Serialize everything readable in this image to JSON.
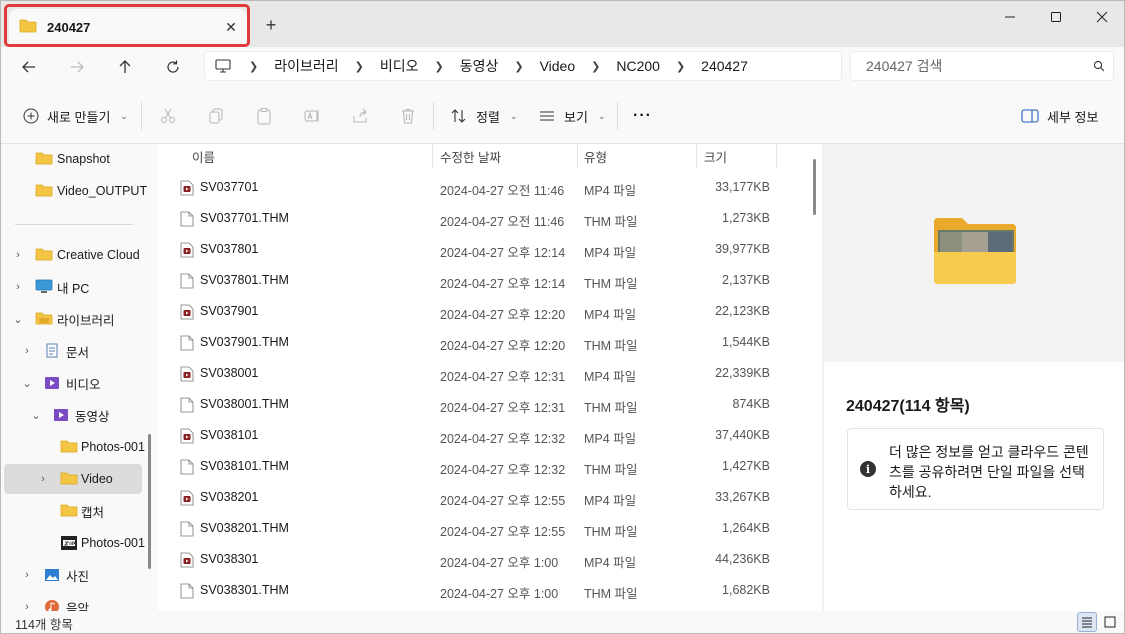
{
  "window": {
    "tab_title": "240427",
    "tab_close": "✕",
    "new_tab": "+"
  },
  "address": {
    "breadcrumbs": [
      "라이브러리",
      "비디오",
      "동영상",
      "Video",
      "NC200",
      "240427"
    ],
    "search_placeholder": "240427 검색"
  },
  "toolbar": {
    "new_label": "새로 만들기",
    "sort_label": "정렬",
    "view_label": "보기",
    "more_label": "···",
    "details_label": "세부 정보"
  },
  "nav": {
    "items": [
      {
        "label": "Snapshot",
        "icon": "folder-icon"
      },
      {
        "label": "Video_OUTPUT",
        "icon": "folder-icon"
      },
      {
        "label": "Creative Cloud",
        "icon": "folder-icon"
      },
      {
        "label": "내 PC",
        "icon": "pc-icon"
      },
      {
        "label": "라이브러리",
        "icon": "library-folder-icon"
      },
      {
        "label": "문서",
        "icon": "documents-icon"
      },
      {
        "label": "비디오",
        "icon": "videos-icon"
      },
      {
        "label": "동영상",
        "icon": "videos-icon"
      },
      {
        "label": "Photos-001",
        "icon": "folder-icon"
      },
      {
        "label": "Video",
        "icon": "folder-icon"
      },
      {
        "label": "캡처",
        "icon": "folder-icon"
      },
      {
        "label": "Photos-001",
        "icon": "zip-folder-icon"
      },
      {
        "label": "사진",
        "icon": "pictures-icon"
      },
      {
        "label": "음악",
        "icon": "music-icon"
      }
    ]
  },
  "columns": {
    "name": "이름",
    "date": "수정한 날짜",
    "type": "유형",
    "size": "크기"
  },
  "files": [
    {
      "name": "SV037701",
      "date": "2024-04-27 오전 11:46",
      "type": "MP4 파일",
      "size": "33,177KB",
      "kind": "mp4"
    },
    {
      "name": "SV037701.THM",
      "date": "2024-04-27 오전 11:46",
      "type": "THM 파일",
      "size": "1,273KB",
      "kind": "thm"
    },
    {
      "name": "SV037801",
      "date": "2024-04-27 오후 12:14",
      "type": "MP4 파일",
      "size": "39,977KB",
      "kind": "mp4"
    },
    {
      "name": "SV037801.THM",
      "date": "2024-04-27 오후 12:14",
      "type": "THM 파일",
      "size": "2,137KB",
      "kind": "thm"
    },
    {
      "name": "SV037901",
      "date": "2024-04-27 오후 12:20",
      "type": "MP4 파일",
      "size": "22,123KB",
      "kind": "mp4"
    },
    {
      "name": "SV037901.THM",
      "date": "2024-04-27 오후 12:20",
      "type": "THM 파일",
      "size": "1,544KB",
      "kind": "thm"
    },
    {
      "name": "SV038001",
      "date": "2024-04-27 오후 12:31",
      "type": "MP4 파일",
      "size": "22,339KB",
      "kind": "mp4"
    },
    {
      "name": "SV038001.THM",
      "date": "2024-04-27 오후 12:31",
      "type": "THM 파일",
      "size": "874KB",
      "kind": "thm"
    },
    {
      "name": "SV038101",
      "date": "2024-04-27 오후 12:32",
      "type": "MP4 파일",
      "size": "37,440KB",
      "kind": "mp4"
    },
    {
      "name": "SV038101.THM",
      "date": "2024-04-27 오후 12:32",
      "type": "THM 파일",
      "size": "1,427KB",
      "kind": "thm"
    },
    {
      "name": "SV038201",
      "date": "2024-04-27 오후 12:55",
      "type": "MP4 파일",
      "size": "33,267KB",
      "kind": "mp4"
    },
    {
      "name": "SV038201.THM",
      "date": "2024-04-27 오후 12:55",
      "type": "THM 파일",
      "size": "1,264KB",
      "kind": "thm"
    },
    {
      "name": "SV038301",
      "date": "2024-04-27 오후 1:00",
      "type": "MP4 파일",
      "size": "44,236KB",
      "kind": "mp4"
    },
    {
      "name": "SV038301.THM",
      "date": "2024-04-27 오후 1:00",
      "type": "THM 파일",
      "size": "1,682KB",
      "kind": "thm"
    }
  ],
  "details": {
    "title": "240427(114 항목)",
    "info_text": "더 많은 정보를 얻고 클라우드 콘텐츠를 공유하려면 단일 파일을 선택하세요."
  },
  "status": {
    "count": "114개 항목"
  },
  "colors": {
    "folder": "#f4c542",
    "highlight": "#e03a3a",
    "mp4_icon": "#8b1e1e"
  }
}
